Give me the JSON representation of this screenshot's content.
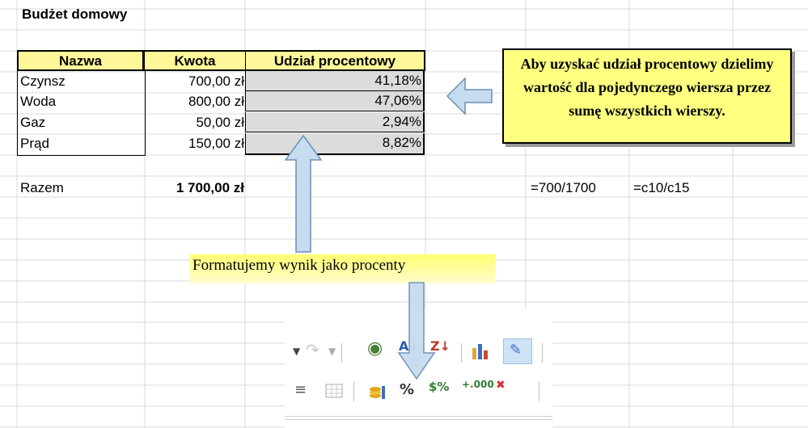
{
  "sheet": {
    "title": "Budżet domowy",
    "headers": [
      "Nazwa",
      "Kwota",
      "Udział procentowy"
    ],
    "rows": [
      {
        "name": "Czynsz",
        "amount": "700,00 zł",
        "percent": "41,18%"
      },
      {
        "name": "Woda",
        "amount": "800,00 zł",
        "percent": "47,06%"
      },
      {
        "name": "Gaz",
        "amount": "50,00 zł",
        "percent": "2,94%"
      },
      {
        "name": "Prąd",
        "amount": "150,00 zł",
        "percent": "8,82%"
      }
    ],
    "total_label": "Razem",
    "total_value": "1 700,00 zł",
    "formula_1": "=700/1700",
    "formula_2": "=c10/c15"
  },
  "callouts": {
    "right_note": "Aby uzyskać udział procentowy dzielimy wartość dla pojedynczego wiersza przez sumę wszystkich wierszy.",
    "bottom_note": "Formatujemy wynik jako procenty"
  },
  "toolbar": {
    "row1_icons": [
      "dropdown-arrow-icon",
      "redo-icon",
      "dropdown-arrow-icon",
      "navigator-icon",
      "sort-ascending-icon",
      "sort-descending-icon",
      "chart-icon",
      "draw-functions-icon"
    ],
    "row2_icons": [
      "align-justify-icon",
      "table-borders-icon",
      "currency-format-icon",
      "percent-format-icon",
      "standard-format-icon",
      "add-decimal-icon",
      "delete-decimal-icon"
    ],
    "percent_glyph": "%"
  },
  "colors": {
    "header_fill": "#fff799",
    "percent_fill": "#dcdcdc",
    "callout_fill": "#ffff80",
    "arrow_fill": "#c6dcef",
    "arrow_stroke": "#6b8fb5"
  }
}
